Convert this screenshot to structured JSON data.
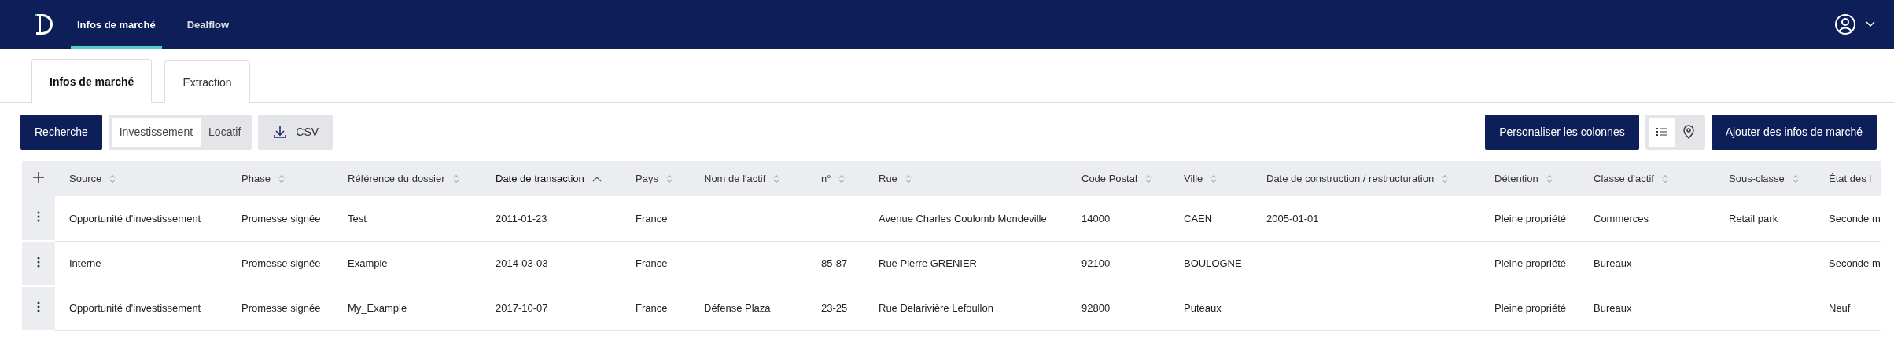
{
  "nav": {
    "items": [
      {
        "label": "Infos de marché",
        "selected": true
      },
      {
        "label": "Dealflow",
        "selected": false
      }
    ]
  },
  "tabs": [
    {
      "label": "Infos de marché",
      "selected": true
    },
    {
      "label": "Extraction",
      "selected": false
    }
  ],
  "toolbar": {
    "search_button": "Recherche",
    "mode": [
      {
        "label": "Investissement",
        "selected": true
      },
      {
        "label": "Locatif",
        "selected": false
      }
    ],
    "csv_button": "CSV",
    "columns_button": "Personaliser les colonnes",
    "views": [
      {
        "kind": "list",
        "selected": true
      },
      {
        "kind": "map",
        "selected": false
      }
    ],
    "add_button": "Ajouter des infos de marché"
  },
  "table": {
    "columns": [
      {
        "label": "Source",
        "sortable": true,
        "sorted": false
      },
      {
        "label": "Phase",
        "sortable": true,
        "sorted": false
      },
      {
        "label": "Référence du dossier",
        "sortable": true,
        "sorted": false
      },
      {
        "label": "Date de transaction",
        "sortable": true,
        "sorted": true
      },
      {
        "label": "Pays",
        "sortable": true,
        "sorted": false
      },
      {
        "label": "Nom de l'actif",
        "sortable": true,
        "sorted": false
      },
      {
        "label": "n°",
        "sortable": true,
        "sorted": false
      },
      {
        "label": "Rue",
        "sortable": true,
        "sorted": false
      },
      {
        "label": "Code Postal",
        "sortable": true,
        "sorted": false
      },
      {
        "label": "Ville",
        "sortable": true,
        "sorted": false
      },
      {
        "label": "Date de construction / restructuration",
        "sortable": true,
        "sorted": false
      },
      {
        "label": "Détention",
        "sortable": true,
        "sorted": false
      },
      {
        "label": "Classe d'actif",
        "sortable": true,
        "sorted": false
      },
      {
        "label": "Sous-classe",
        "sortable": true,
        "sorted": false
      },
      {
        "label": "État des l",
        "sortable": false,
        "sorted": false
      }
    ],
    "rows": [
      [
        "Opportunité d'investissement",
        "Promesse signée",
        "Test",
        "2011-01-23",
        "France",
        "",
        "",
        "Avenue Charles Coulomb Mondeville",
        "14000",
        "CAEN",
        "2005-01-01",
        "Pleine propriété",
        "Commerces",
        "Retail park",
        "Seconde m"
      ],
      [
        "Interne",
        "Promesse signée",
        "Example",
        "2014-03-03",
        "France",
        "",
        "85-87",
        "Rue Pierre GRENIER",
        "92100",
        "BOULOGNE",
        "",
        "Pleine propriété",
        "Bureaux",
        "",
        "Seconde m"
      ],
      [
        "Opportunité d'investissement",
        "Promesse signée",
        "My_Example",
        "2017-10-07",
        "France",
        "Défense Plaza",
        "23-25",
        "Rue Delarivière Lefoullon",
        "92800",
        "Puteaux",
        "",
        "Pleine propriété",
        "Bureaux",
        "",
        "Neuf"
      ]
    ]
  }
}
